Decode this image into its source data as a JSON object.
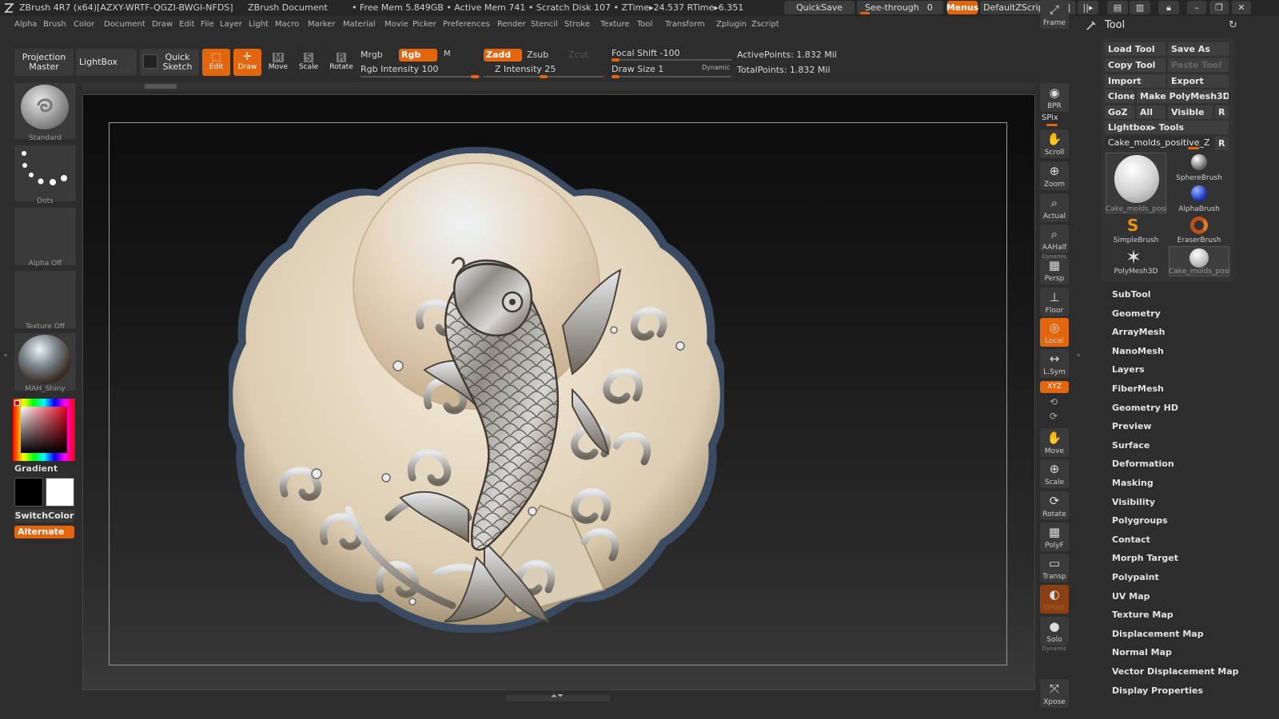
{
  "titlebar": {
    "app_title": "ZBrush 4R7 (x64)[AZXY-WRTF-QGZI-BWGI-NFDS]",
    "document": "ZBrush Document",
    "free_mem": "• Free Mem 5.849GB • Active Mem 741 • Scratch Disk 107 • ZTime▸24.537 RTime▸6.351",
    "quicksave": "QuickSave",
    "see_through": "See-through",
    "see_through_value": "0",
    "menus": "Menus",
    "default_zscript": "DefaultZScript"
  },
  "menubar": [
    "Alpha",
    "Brush",
    "Color",
    "Document",
    "Draw",
    "Edit",
    "File",
    "Layer",
    "Light",
    "Macro",
    "Marker",
    "Material",
    "Movie",
    "Picker",
    "Preferences",
    "Render",
    "Stencil",
    "Stroke",
    "Texture",
    "Tool",
    "Transform",
    "Zplugin",
    "Zscript"
  ],
  "toolbar": {
    "projection_master": "Projection Master",
    "lightbox": "LightBox",
    "quick_sketch": "Quick Sketch",
    "edit": "Edit",
    "draw": "Draw",
    "move": "Move",
    "scale": "Scale",
    "rotate": "Rotate",
    "mrgb": "Mrgb",
    "rgb": "Rgb",
    "m": "M",
    "rgb_intensity": "Rgb Intensity 100",
    "zadd": "Zadd",
    "zsub": "Zsub",
    "zcut": "Zcut",
    "z_intensity": "Z Intensity 25",
    "focal_shift": "Focal Shift -100",
    "draw_size": "Draw Size 1",
    "dynamic": "Dynamic",
    "active_points": "ActivePoints: 1.832 Mil",
    "total_points": "TotalPoints: 1.832 Mil"
  },
  "leftshelf": {
    "brush": "Standard",
    "stroke": "Dots",
    "alpha": "Alpha Off",
    "texture": "Texture Off",
    "material": "MAH_Shiny",
    "gradient": "Gradient",
    "switchcolor": "SwitchColor",
    "alternate": "Alternate"
  },
  "rightshelf": [
    "BPR",
    "SPix",
    "Scroll",
    "Zoom",
    "Actual",
    "AAHalf",
    "Persp",
    "Floor",
    "Local",
    "L.Sym",
    "XYZ",
    "Frame",
    "Move",
    "Scale",
    "Rotate",
    "PolyF",
    "Transp",
    "Ghost",
    "Solo",
    "Xpose"
  ],
  "rightshelf_small": {
    "dynamic1": "Dynamic",
    "dynamic2": "Dynamic",
    "lsym_label": "L.Sym"
  },
  "toolpanel": {
    "title": "Tool",
    "load_tool": "Load Tool",
    "save_as": "Save As",
    "copy_tool": "Copy Tool",
    "paste_tool": "Paste Tool",
    "import": "Import",
    "export": "Export",
    "clone": "Clone",
    "make_polymesh": "Make PolyMesh3D",
    "goz": "GoZ",
    "all": "All",
    "visible": "Visible",
    "r": "R",
    "lightbox_tools": "Lightbox▸ Tools",
    "current_tool": "Cake_molds_positive_Z",
    "current_tool_r": "R",
    "thumbs": {
      "main": "Cake_molds_posi",
      "sphere": "SphereBrush",
      "alpha": "AlphaBrush",
      "simple": "SimpleBrush",
      "eraser": "EraserBrush",
      "polymesh": "PolyMesh3D",
      "cake2": "Cake_molds_posi"
    },
    "subpalettes": [
      "SubTool",
      "Geometry",
      "ArrayMesh",
      "NanoMesh",
      "Layers",
      "FiberMesh",
      "Geometry HD",
      "Preview",
      "Surface",
      "Deformation",
      "Masking",
      "Visibility",
      "Polygroups",
      "Contact",
      "Morph Target",
      "Polypaint",
      "UV Map",
      "Texture Map",
      "Displacement Map",
      "Normal Map",
      "Vector Displacement Map",
      "Display Properties"
    ]
  },
  "colors": {
    "accent": "#e2660e",
    "canvas": "#0e0e0e",
    "medallion": "#e8dcc8"
  }
}
